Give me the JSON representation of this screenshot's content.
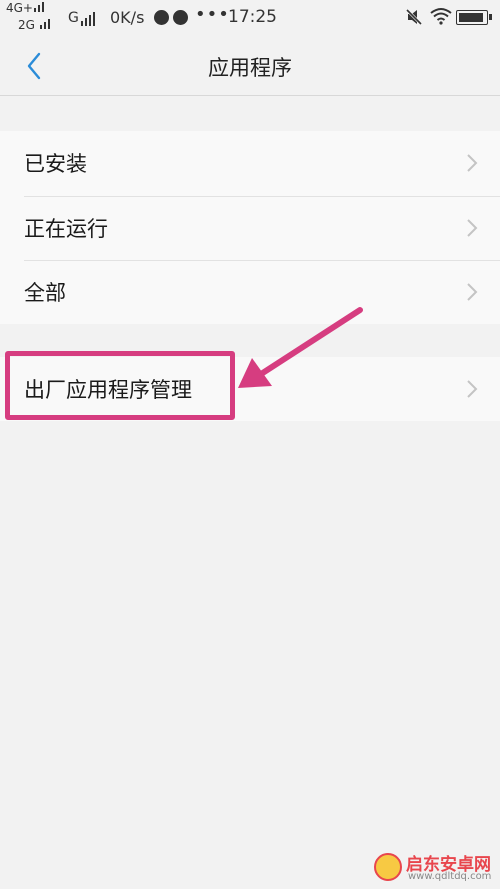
{
  "status_bar": {
    "network_top": "4G+",
    "network_bottom": "2G",
    "network_g": "G",
    "speed": "0K/s",
    "dots": "•••",
    "time": "17:25"
  },
  "header": {
    "title": "应用程序"
  },
  "list_group_1": {
    "items": [
      {
        "label": "已安装"
      },
      {
        "label": "正在运行"
      },
      {
        "label": "全部"
      }
    ]
  },
  "list_group_2": {
    "items": [
      {
        "label": "出厂应用程序管理"
      }
    ]
  },
  "annotation": {
    "color": "#d63d80"
  },
  "watermark": {
    "text": "启东安卓网",
    "url": "www.qdltdq.com"
  },
  "colors": {
    "accent": "#2b8cd8",
    "background": "#f2f2f2",
    "row_background": "#f9f9f9"
  }
}
